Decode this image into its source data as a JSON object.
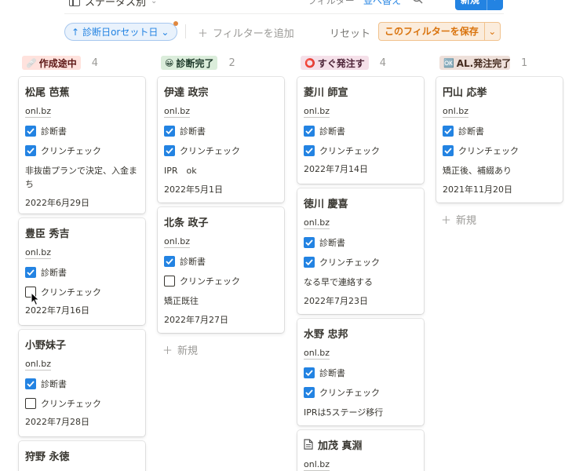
{
  "toolbar": {
    "view_name": "ステータス別",
    "filter_label": "フィルター",
    "sort_label": "並べ替え",
    "new_label": "新規"
  },
  "filter_bar": {
    "active_filter": "診断日orセット日",
    "add_filter": "フィルターを追加",
    "reset": "リセット",
    "save_filter": "このフィルターを保存"
  },
  "colors": {
    "accent": "#2383e2",
    "save_filter_text": "#d9730d",
    "tag_red_bg": "#ffe2dd",
    "tag_green_bg": "#dbeddb",
    "tag_pink_bg": "#f5e0e9",
    "tag_brown_bg": "#eee0da"
  },
  "board": {
    "new_item_label": "新規",
    "columns": [
      {
        "name": "作成途中",
        "emoji": "🩹",
        "count": "4",
        "cards": [
          {
            "title": "松尾 芭蕉",
            "url": "onl.bz",
            "check1_label": "診断書",
            "check2_label": "クリンチェック",
            "note": "非抜歯プランで決定、入金まち",
            "date": "2022年6月29日"
          },
          {
            "title": "豊臣 秀吉",
            "url": "onl.bz",
            "check1_label": "診断書",
            "check2_label": "クリンチェック",
            "date": "2022年7月16日"
          },
          {
            "title": "小野妹子",
            "url": "onl.bz",
            "check1_label": "診断書",
            "check2_label": "クリンチェック",
            "date": "2022年7月28日"
          },
          {
            "title": "狩野 永徳"
          }
        ]
      },
      {
        "name": "診断完了",
        "emoji": "😀",
        "count": "2",
        "cards": [
          {
            "title": "伊達 政宗",
            "url": "onl.bz",
            "check1_label": "診断書",
            "check2_label": "クリンチェック",
            "note": "IPR　ok",
            "date": "2022年5月1日"
          },
          {
            "title": "北条 政子",
            "url": "onl.bz",
            "check1_label": "診断書",
            "check2_label": "クリンチェック",
            "note": "矯正既往",
            "date": "2022年7月27日"
          }
        ]
      },
      {
        "name": "すぐ発注す",
        "emoji": "⭕",
        "count": "4",
        "cards": [
          {
            "title": "菱川 師宣",
            "url": "onl.bz",
            "check1_label": "診断書",
            "check2_label": "クリンチェック",
            "date": "2022年7月14日"
          },
          {
            "title": "徳川 慶喜",
            "url": "onl.bz",
            "check1_label": "診断書",
            "check2_label": "クリンチェック",
            "note": "なる早で連絡する",
            "date": "2022年7月23日"
          },
          {
            "title": "水野 忠邦",
            "url": "onl.bz",
            "check1_label": "診断書",
            "check2_label": "クリンチェック",
            "note": "IPRは5ステージ移行"
          },
          {
            "title": "加茂 真淵",
            "url": "onl.bz"
          }
        ]
      },
      {
        "name": "AL.発注完了",
        "emoji": "🆗",
        "count": "1",
        "cards": [
          {
            "title": "円山 応挙",
            "url": "onl.bz",
            "check1_label": "診断書",
            "check2_label": "クリンチェック",
            "note": "矯正後、補綴あり",
            "date": "2021年11月20日"
          }
        ]
      }
    ]
  }
}
